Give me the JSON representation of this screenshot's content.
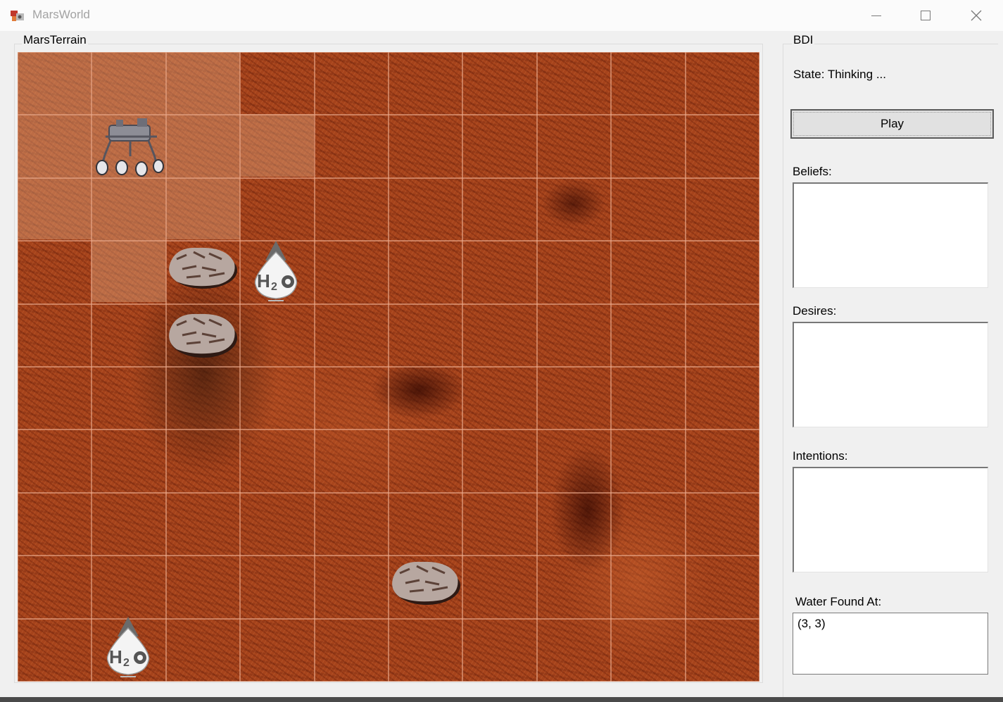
{
  "window": {
    "title": "MarsWorld"
  },
  "terrain": {
    "label": "MarsTerrain",
    "columns": 10,
    "rows": 10
  },
  "bdi": {
    "label": "BDI",
    "state": "State: Thinking ...",
    "play_label": "Play",
    "beliefs_label": "Beliefs:",
    "desires_label": "Desires:",
    "intentions_label": "Intentions:",
    "water_found_label": "Water Found At:",
    "water_found_items": [
      "(3, 3)"
    ],
    "beliefs_items": [],
    "desires_items": [],
    "intentions_items": []
  },
  "icons": {
    "app": "mars-world-app-icon",
    "rover": "rover-icon",
    "rock": "rock-icon",
    "water": "water-drop-icon"
  },
  "colors": {
    "terrain": "#a6431b",
    "grid_line": "#e9a88a"
  }
}
